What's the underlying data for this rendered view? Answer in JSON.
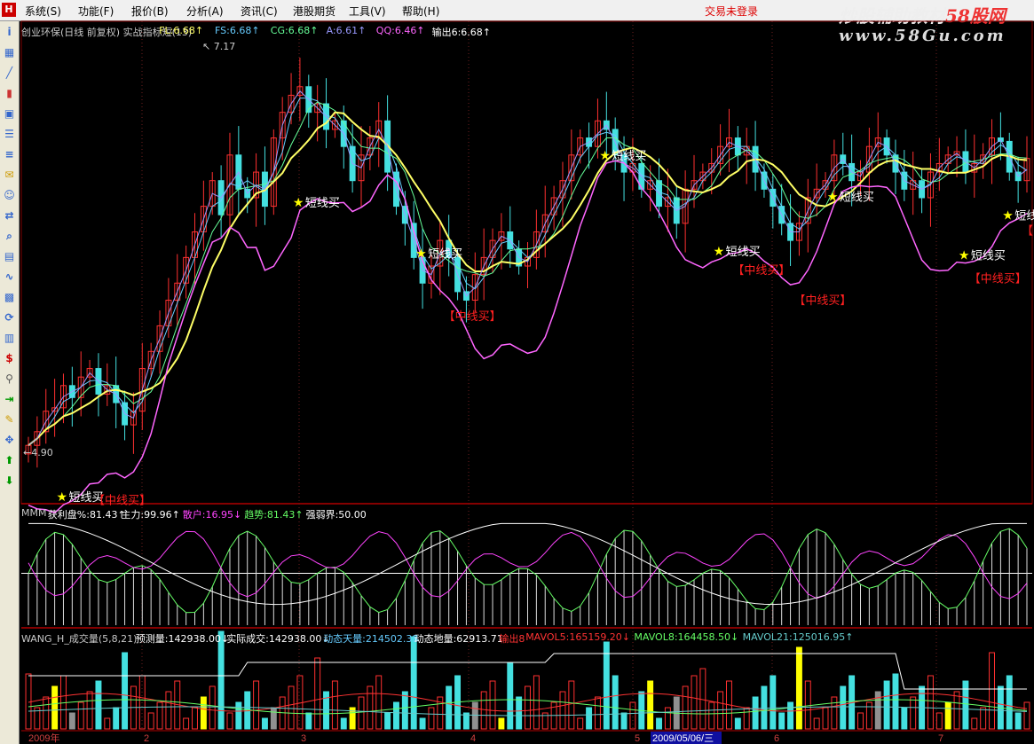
{
  "menu": {
    "items": [
      "系统(S)",
      "功能(F)",
      "报价(B)",
      "分析(A)",
      "资讯(C)",
      "港股期货",
      "工具(V)",
      "帮助(H)"
    ],
    "login_status": "交易未登录",
    "watermark_1a": "炒股辅助教材",
    "watermark_1b": "58股网",
    "watermark_2": "www.58Gu.com",
    "logo": "H"
  },
  "toolbar": {
    "icons": [
      "info-icon",
      "grid-icon",
      "line-chart-icon",
      "bar-chart-icon",
      "window-icon",
      "list-icon",
      "news-icon",
      "mail-icon",
      "users-icon",
      "compare-icon",
      "search-icon",
      "document-icon",
      "indicator-icon",
      "stats-icon",
      "refresh-icon",
      "table-icon",
      "dollar-icon",
      "link-icon",
      "export-icon",
      "pencil-icon",
      "move-icon",
      "arrow-up-icon",
      "arrow-down-icon"
    ]
  },
  "main_header": [
    {
      "t": "创业环保(日线 前复权) 实战指标短(13)",
      "c": "#c8c8c8"
    },
    {
      "t": "FL:6.68↑",
      "c": "#ffff66"
    },
    {
      "t": "FS:6.68↑",
      "c": "#66ccff"
    },
    {
      "t": "CG:6.68↑",
      "c": "#66ff99"
    },
    {
      "t": "A:6.61↑",
      "c": "#9999ff"
    },
    {
      "t": "QQ:6.46↑",
      "c": "#ff66ff"
    },
    {
      "t": "输出6:6.68↑",
      "c": "#ffffff"
    }
  ],
  "mid_header": [
    {
      "t": "MMM",
      "c": "#c8c8c8"
    },
    {
      "t": "获利盘%:81.43↑",
      "c": "#ffffff"
    },
    {
      "t": "主力:99.96↑",
      "c": "#ffffff"
    },
    {
      "t": "散户:16.95↓",
      "c": "#ff44ff"
    },
    {
      "t": "趋势:81.43↑",
      "c": "#66ff66"
    },
    {
      "t": "强弱界:50.00",
      "c": "#ffffff"
    }
  ],
  "vol_header": [
    {
      "t": "WANG_H_成交量(5,8,21)",
      "c": "#c8c8c8"
    },
    {
      "t": "预测量:142938.00↓",
      "c": "#ffffff"
    },
    {
      "t": "实际成交:142938.00↓",
      "c": "#ffffff"
    },
    {
      "t": "动态天量:214502.38",
      "c": "#66ccff"
    },
    {
      "t": "动态地量:62913.71",
      "c": "#ffffff"
    },
    {
      "t": "输出8",
      "c": "#ff3333"
    },
    {
      "t": "MAVOL5:165159.20↓",
      "c": "#ff3333"
    },
    {
      "t": "MAVOL8:164458.50↓",
      "c": "#66ff66"
    },
    {
      "t": "MAVOL21:125016.95↑",
      "c": "#66cccc"
    }
  ],
  "price_labels": {
    "high": "7.17",
    "low": "4.90"
  },
  "signals": {
    "short_buy": "短线买",
    "mid_buy": "【中线买】"
  },
  "chart_data": {
    "type": "candlestick",
    "symbol": "创业环保",
    "ylim": [
      4.7,
      7.4
    ],
    "x_axis_labels": [
      "2009年",
      "2",
      "3",
      "4",
      "5",
      "6",
      "7"
    ],
    "highlighted_date": "2009/05/06/三",
    "close": [
      5.0,
      5.08,
      5.2,
      5.22,
      5.35,
      5.28,
      5.4,
      5.45,
      5.3,
      5.35,
      5.25,
      5.12,
      5.2,
      5.45,
      5.55,
      5.7,
      5.85,
      5.95,
      6.1,
      6.25,
      6.4,
      6.55,
      6.35,
      6.7,
      6.5,
      6.45,
      6.6,
      6.4,
      6.8,
      6.95,
      7.05,
      7.1,
      6.95,
      7.0,
      6.85,
      6.9,
      6.75,
      6.55,
      6.7,
      6.8,
      6.9,
      6.6,
      6.4,
      6.3,
      6.1,
      5.95,
      6.05,
      6.2,
      6.1,
      5.9,
      5.85,
      6.0,
      6.1,
      6.2,
      6.25,
      6.15,
      6.05,
      6.1,
      6.25,
      6.35,
      6.45,
      6.55,
      6.7,
      6.8,
      6.75,
      6.9,
      6.85,
      6.7,
      6.6,
      6.65,
      6.5,
      6.55,
      6.4,
      6.45,
      6.3,
      6.5,
      6.55,
      6.6,
      6.65,
      6.75,
      6.8,
      6.7,
      6.75,
      6.6,
      6.5,
      6.4,
      6.3,
      6.2,
      6.3,
      6.45,
      6.5,
      6.55,
      6.7,
      6.65,
      6.55,
      6.6,
      6.75,
      6.8,
      6.7,
      6.6,
      6.5,
      6.55,
      6.45,
      6.6,
      6.65,
      6.7,
      6.72,
      6.6,
      6.65,
      6.7,
      6.8,
      6.78,
      6.6,
      6.55,
      6.68
    ],
    "ma": {
      "FL": 6.68,
      "FS": 6.68,
      "CG": 6.68,
      "A": 6.61,
      "QQ": 6.46
    },
    "signal_points": [
      {
        "kind": "short",
        "idx": 4
      },
      {
        "kind": "mid",
        "idx": 8
      },
      {
        "kind": "short",
        "idx": 31
      },
      {
        "kind": "mid",
        "idx": 48
      },
      {
        "kind": "short",
        "idx": 45
      },
      {
        "kind": "short",
        "idx": 66
      },
      {
        "kind": "short",
        "idx": 79
      },
      {
        "kind": "mid",
        "idx": 81
      },
      {
        "kind": "short",
        "idx": 92
      },
      {
        "kind": "mid",
        "idx": 88
      },
      {
        "kind": "short",
        "idx": 107
      },
      {
        "kind": "short",
        "idx": 112
      },
      {
        "kind": "mid",
        "idx": 108
      },
      {
        "kind": "mid",
        "idx": 114
      }
    ]
  }
}
